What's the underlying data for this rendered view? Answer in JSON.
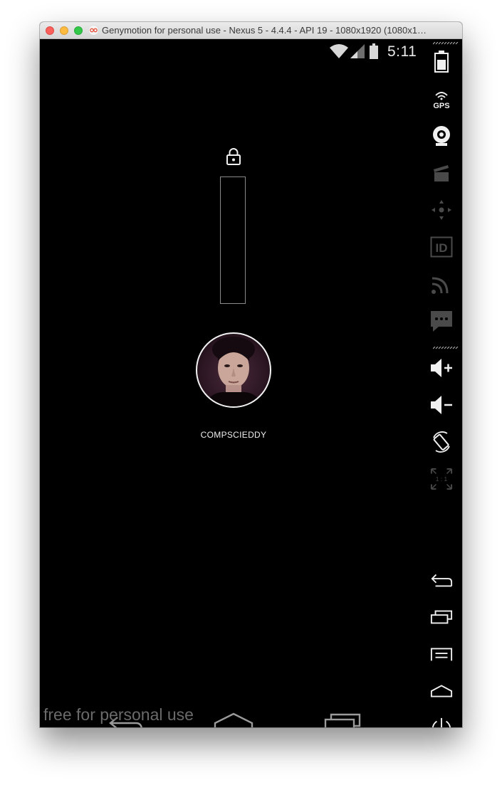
{
  "window": {
    "title": "Genymotion for personal use - Nexus 5 - 4.4.4 - API 19 - 1080x1920 (1080x1…"
  },
  "statusbar": {
    "time": "5:11"
  },
  "lockscreen": {
    "user_name": "COMPSCIEDDY"
  },
  "watermark": "free for personal use",
  "sidebar": {
    "gps_label": "GPS",
    "id_label": "ID",
    "pixel_ratio_label": "1 : 1"
  },
  "icons": [
    "battery-icon",
    "gps-icon",
    "webcam-icon",
    "capture-icon",
    "remote-control-icon",
    "identifiers-icon",
    "network-icon",
    "sms-icon",
    "volume-up-icon",
    "volume-down-icon",
    "rotate-icon",
    "pixel-perfect-icon",
    "back-icon",
    "recent-apps-icon",
    "menu-icon",
    "home-icon",
    "power-icon",
    "lock-icon"
  ],
  "colors": {
    "screen_bg": "#000000",
    "titlebar": "#e2e2e2",
    "close": "#fc605c",
    "minimize": "#fdbc40",
    "maximize": "#34c84a"
  }
}
